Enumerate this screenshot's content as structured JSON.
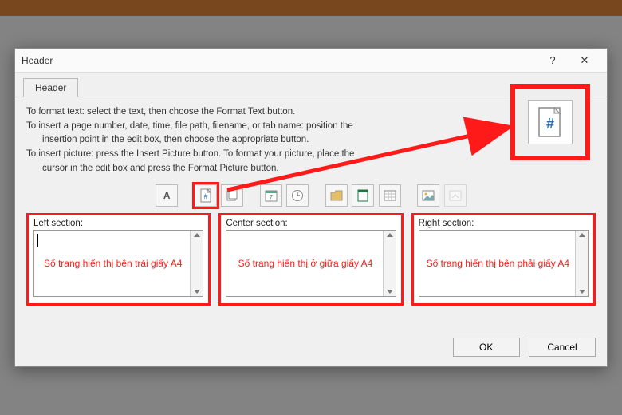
{
  "dialog": {
    "title": "Header",
    "help_symbol": "?",
    "close_symbol": "✕",
    "tab_label": "Header",
    "instructions": {
      "line1": "To format text:  select the text, then choose the Format Text button.",
      "line2a": "To insert a page number, date, time, file path, filename, or tab name:  position the",
      "line2b": "insertion point in the edit box, then choose the appropriate button.",
      "line3a": "To insert picture: press the Insert Picture button.  To format your picture, place the",
      "line3b": "cursor in the edit box and press the Format Picture button."
    },
    "toolbar": {
      "format_text": "A",
      "page_number": "#",
      "pages": "pages",
      "date": "date",
      "time": "time",
      "file_path": "path",
      "file_name": "file",
      "sheet_name": "sheet",
      "picture": "pic",
      "format_picture": "fmtpic"
    },
    "sections": {
      "left": {
        "label_prefix": "L",
        "label_rest": "eft section:",
        "annotation": "Số trang hiển thị bên trái giấy A4"
      },
      "center": {
        "label_prefix": "C",
        "label_rest": "enter section:",
        "annotation": "Số trang hiển thị ở giữa giấy A4"
      },
      "right": {
        "label_prefix": "R",
        "label_rest": "ight section:",
        "annotation": "Số trang hiển thị bên phải giấy A4"
      }
    },
    "buttons": {
      "ok": "OK",
      "cancel": "Cancel"
    }
  }
}
